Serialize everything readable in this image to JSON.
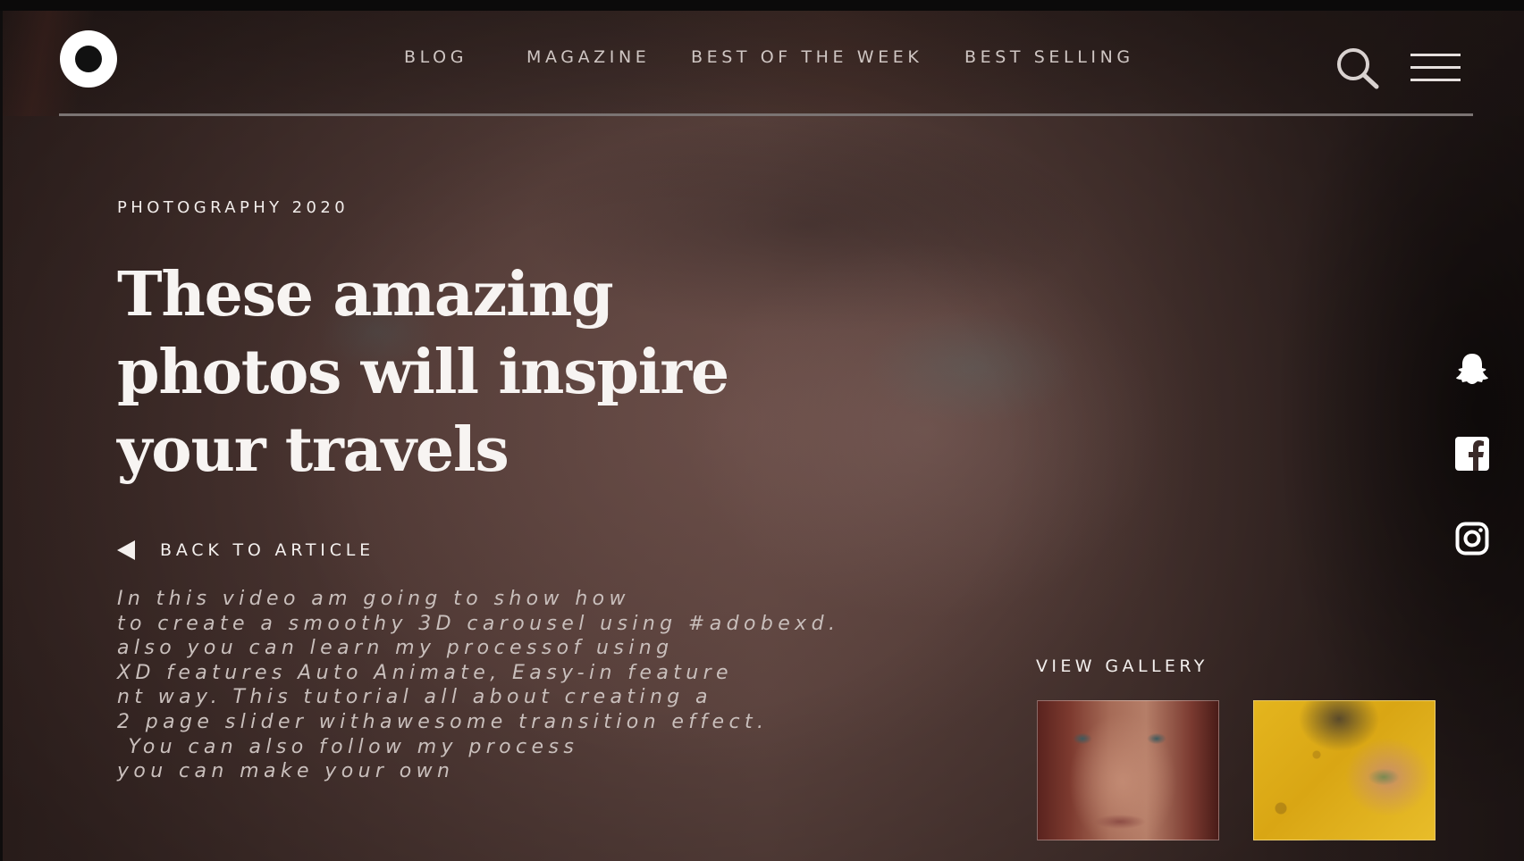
{
  "header": {
    "logo_name": "circle-logo",
    "nav": [
      {
        "label": "BLOG"
      },
      {
        "label": "MAGAZINE"
      },
      {
        "label": "BEST OF THE WEEK"
      },
      {
        "label": "BEST SELLING"
      }
    ],
    "search_icon": "search-icon",
    "menu_icon": "hamburger-menu-icon"
  },
  "hero": {
    "kicker": "PHOTOGRAPHY 2020",
    "headline_lines": [
      "These amazing",
      "photos will inspire",
      "your travels"
    ],
    "back_link": "BACK TO ARTICLE",
    "body_lines": [
      "In this video am going to show how",
      "to create a smoothy 3D carousel using #adobexd.",
      "also you can learn my processof using",
      "XD features Auto Animate, Easy-in feature",
      "nt way. This tutorial all about creating a",
      "2 page slider withawesome transition effect.",
      " You can also follow my process",
      "you can make your own"
    ]
  },
  "social": [
    "snapchat-icon",
    "facebook-icon",
    "instagram-icon"
  ],
  "gallery": {
    "title": "VIEW GALLERY",
    "thumbnails": [
      "portrait-thumbnail",
      "yellow-leaf-eye-thumbnail"
    ]
  },
  "colors": {
    "text_primary": "#f7f4f2",
    "text_muted": "#c9bfbc",
    "nav_text": "#cfc6c3",
    "rule": "#7b7473"
  }
}
